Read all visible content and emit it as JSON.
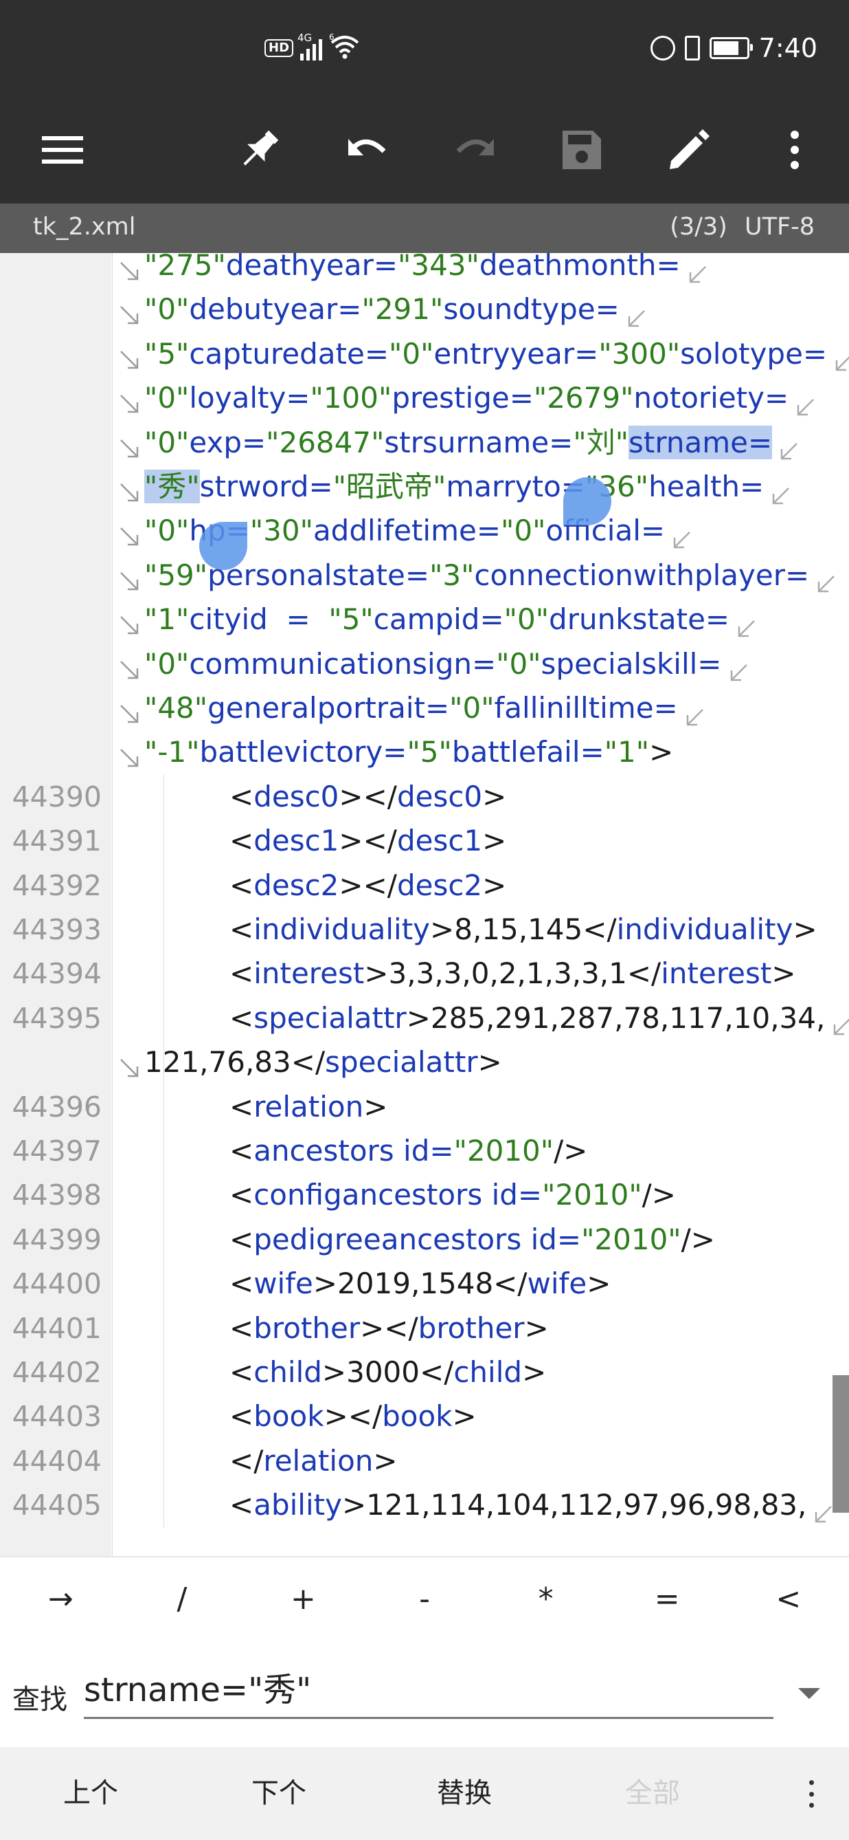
{
  "status_bar": {
    "hd": "HD",
    "network": "4G",
    "wifi_badge": "6",
    "battery_level_percent": 80,
    "time": "7:40"
  },
  "toolbar": {
    "menu_icon": "menu-icon",
    "pin_icon": "pin-icon",
    "undo_icon": "undo-icon",
    "redo_icon": "redo-icon",
    "save_icon": "save-icon",
    "edit_icon": "pencil-icon",
    "more_icon": "more-vert-icon"
  },
  "file_bar": {
    "filename": "tk_2.xml",
    "position": "(3/3)",
    "encoding": "UTF-8"
  },
  "editor": {
    "wrapped_lines": [
      [
        {
          "t": "\"275\"",
          "c": "v"
        },
        {
          "t": "deathyear=",
          "c": "k"
        },
        {
          "t": "\"343\"",
          "c": "v"
        },
        {
          "t": "deathmonth=",
          "c": "k"
        }
      ],
      [
        {
          "t": "\"0\"",
          "c": "v"
        },
        {
          "t": "debutyear=",
          "c": "k"
        },
        {
          "t": "\"291\"",
          "c": "v"
        },
        {
          "t": "soundtype=",
          "c": "k"
        }
      ],
      [
        {
          "t": "\"5\"",
          "c": "v"
        },
        {
          "t": "capturedate=",
          "c": "k"
        },
        {
          "t": "\"0\"",
          "c": "v"
        },
        {
          "t": "entryyear=",
          "c": "k"
        },
        {
          "t": "\"300\"",
          "c": "v"
        },
        {
          "t": "solotype=",
          "c": "k"
        }
      ],
      [
        {
          "t": "\"0\"",
          "c": "v"
        },
        {
          "t": "loyalty=",
          "c": "k"
        },
        {
          "t": "\"100\"",
          "c": "v"
        },
        {
          "t": "prestige=",
          "c": "k"
        },
        {
          "t": "\"2679\"",
          "c": "v"
        },
        {
          "t": "notoriety=",
          "c": "k"
        }
      ],
      [
        {
          "t": "\"0\"",
          "c": "v"
        },
        {
          "t": "exp=",
          "c": "k"
        },
        {
          "t": "\"26847\"",
          "c": "v"
        },
        {
          "t": "strsurname=",
          "c": "k"
        },
        {
          "t": "\"刘\"",
          "c": "v"
        },
        {
          "t": "strname=",
          "c": "k",
          "sel": true
        }
      ],
      [
        {
          "t": "\"秀\"",
          "c": "v",
          "sel": true
        },
        {
          "t": "strword=",
          "c": "k"
        },
        {
          "t": "\"昭武帝\"",
          "c": "v"
        },
        {
          "t": "marryto=",
          "c": "k"
        },
        {
          "t": "\"36\"",
          "c": "v"
        },
        {
          "t": "health=",
          "c": "k"
        }
      ],
      [
        {
          "t": "\"0\"",
          "c": "v"
        },
        {
          "t": "hp=",
          "c": "k"
        },
        {
          "t": "\"30\"",
          "c": "v"
        },
        {
          "t": "addlifetime=",
          "c": "k"
        },
        {
          "t": "\"0\"",
          "c": "v"
        },
        {
          "t": "official=",
          "c": "k"
        }
      ],
      [
        {
          "t": "\"59\"",
          "c": "v"
        },
        {
          "t": "personalstate=",
          "c": "k"
        },
        {
          "t": "\"3\"",
          "c": "v"
        },
        {
          "t": "connectionwithplayer=",
          "c": "k"
        }
      ],
      [
        {
          "t": "\"1\"",
          "c": "v"
        },
        {
          "t": "cityid  =  ",
          "c": "k"
        },
        {
          "t": "\"5\"",
          "c": "v"
        },
        {
          "t": "campid=",
          "c": "k"
        },
        {
          "t": "\"0\"",
          "c": "v"
        },
        {
          "t": "drunkstate=",
          "c": "k"
        }
      ],
      [
        {
          "t": "\"0\"",
          "c": "v"
        },
        {
          "t": "communicationsign=",
          "c": "k"
        },
        {
          "t": "\"0\"",
          "c": "v"
        },
        {
          "t": "specialskill=",
          "c": "k"
        }
      ],
      [
        {
          "t": "\"48\"",
          "c": "v"
        },
        {
          "t": "generalportrait=",
          "c": "k"
        },
        {
          "t": "\"0\"",
          "c": "v"
        },
        {
          "t": "fallinilltime=",
          "c": "k"
        }
      ],
      [
        {
          "t": "\"-1\"",
          "c": "v"
        },
        {
          "t": "battlevictory=",
          "c": "k"
        },
        {
          "t": "\"5\"",
          "c": "v"
        },
        {
          "t": "battlefail=",
          "c": "k"
        },
        {
          "t": "\"1\"",
          "c": "v"
        },
        {
          "t": ">",
          "c": "p"
        }
      ]
    ],
    "wrapped_has_end_mark": [
      true,
      true,
      true,
      true,
      true,
      true,
      true,
      true,
      true,
      true,
      true,
      false
    ],
    "numbered_lines": [
      {
        "n": "44390",
        "parts": [
          {
            "t": "<",
            "c": "p"
          },
          {
            "t": "desc0",
            "c": "k"
          },
          {
            "t": "></",
            "c": "p"
          },
          {
            "t": "desc0",
            "c": "k"
          },
          {
            "t": ">",
            "c": "p"
          }
        ]
      },
      {
        "n": "44391",
        "parts": [
          {
            "t": "<",
            "c": "p"
          },
          {
            "t": "desc1",
            "c": "k"
          },
          {
            "t": "></",
            "c": "p"
          },
          {
            "t": "desc1",
            "c": "k"
          },
          {
            "t": ">",
            "c": "p"
          }
        ]
      },
      {
        "n": "44392",
        "parts": [
          {
            "t": "<",
            "c": "p"
          },
          {
            "t": "desc2",
            "c": "k"
          },
          {
            "t": "></",
            "c": "p"
          },
          {
            "t": "desc2",
            "c": "k"
          },
          {
            "t": ">",
            "c": "p"
          }
        ]
      },
      {
        "n": "44393",
        "parts": [
          {
            "t": "<",
            "c": "p"
          },
          {
            "t": "individuality",
            "c": "k"
          },
          {
            "t": ">8,15,145</",
            "c": "p"
          },
          {
            "t": "individuality",
            "c": "k"
          },
          {
            "t": ">",
            "c": "p"
          }
        ]
      },
      {
        "n": "44394",
        "parts": [
          {
            "t": "<",
            "c": "p"
          },
          {
            "t": "interest",
            "c": "k"
          },
          {
            "t": ">3,3,3,0,2,1,3,3,1</",
            "c": "p"
          },
          {
            "t": "interest",
            "c": "k"
          },
          {
            "t": ">",
            "c": "p"
          }
        ]
      },
      {
        "n": "44395",
        "parts": [
          {
            "t": "<",
            "c": "p"
          },
          {
            "t": "specialattr",
            "c": "k"
          },
          {
            "t": ">285,291,287,78,117,10,34,",
            "c": "p"
          }
        ],
        "wrap_end": true,
        "continuation": [
          {
            "t": "121,76,83</",
            "c": "p"
          },
          {
            "t": "specialattr",
            "c": "k"
          },
          {
            "t": ">",
            "c": "p"
          }
        ]
      },
      {
        "n": "44396",
        "parts": [
          {
            "t": "<",
            "c": "p"
          },
          {
            "t": "relation",
            "c": "k"
          },
          {
            "t": ">",
            "c": "p"
          }
        ]
      },
      {
        "n": "44397",
        "parts": [
          {
            "t": "<",
            "c": "p"
          },
          {
            "t": "ancestors",
            "c": "k"
          },
          {
            "t": " ",
            "c": "p"
          },
          {
            "t": "id=",
            "c": "k"
          },
          {
            "t": "\"2010\"",
            "c": "v"
          },
          {
            "t": "/>",
            "c": "p"
          }
        ]
      },
      {
        "n": "44398",
        "parts": [
          {
            "t": "<",
            "c": "p"
          },
          {
            "t": "configancestors",
            "c": "k"
          },
          {
            "t": " ",
            "c": "p"
          },
          {
            "t": "id=",
            "c": "k"
          },
          {
            "t": "\"2010\"",
            "c": "v"
          },
          {
            "t": "/>",
            "c": "p"
          }
        ]
      },
      {
        "n": "44399",
        "parts": [
          {
            "t": "<",
            "c": "p"
          },
          {
            "t": "pedigreeancestors",
            "c": "k"
          },
          {
            "t": " ",
            "c": "p"
          },
          {
            "t": "id=",
            "c": "k"
          },
          {
            "t": "\"2010\"",
            "c": "v"
          },
          {
            "t": "/>",
            "c": "p"
          }
        ]
      },
      {
        "n": "44400",
        "parts": [
          {
            "t": "<",
            "c": "p"
          },
          {
            "t": "wife",
            "c": "k"
          },
          {
            "t": ">2019,1548</",
            "c": "p"
          },
          {
            "t": "wife",
            "c": "k"
          },
          {
            "t": ">",
            "c": "p"
          }
        ]
      },
      {
        "n": "44401",
        "parts": [
          {
            "t": "<",
            "c": "p"
          },
          {
            "t": "brother",
            "c": "k"
          },
          {
            "t": "></",
            "c": "p"
          },
          {
            "t": "brother",
            "c": "k"
          },
          {
            "t": ">",
            "c": "p"
          }
        ]
      },
      {
        "n": "44402",
        "parts": [
          {
            "t": "<",
            "c": "p"
          },
          {
            "t": "child",
            "c": "k"
          },
          {
            "t": ">3000</",
            "c": "p"
          },
          {
            "t": "child",
            "c": "k"
          },
          {
            "t": ">",
            "c": "p"
          }
        ]
      },
      {
        "n": "44403",
        "parts": [
          {
            "t": "<",
            "c": "p"
          },
          {
            "t": "book",
            "c": "k"
          },
          {
            "t": "></",
            "c": "p"
          },
          {
            "t": "book",
            "c": "k"
          },
          {
            "t": ">",
            "c": "p"
          }
        ]
      },
      {
        "n": "44404",
        "parts": [
          {
            "t": "</",
            "c": "p"
          },
          {
            "t": "relation",
            "c": "k"
          },
          {
            "t": ">",
            "c": "p"
          }
        ]
      },
      {
        "n": "44405",
        "parts": [
          {
            "t": "<",
            "c": "p"
          },
          {
            "t": "ability",
            "c": "k"
          },
          {
            "t": ">121,114,104,112,97,96,98,83,",
            "c": "p"
          }
        ],
        "wrap_end": true
      }
    ],
    "colors": {
      "keyword": "#1b39b3",
      "value": "#2e7d1d",
      "selection": "#b9cdf1"
    }
  },
  "symbols": [
    "→",
    "/",
    "+",
    "-",
    "*",
    "=",
    "<"
  ],
  "find": {
    "label": "查找",
    "query": "strname=\"秀\""
  },
  "actions": {
    "prev": "上个",
    "next": "下个",
    "replace": "替换",
    "all": "全部"
  }
}
